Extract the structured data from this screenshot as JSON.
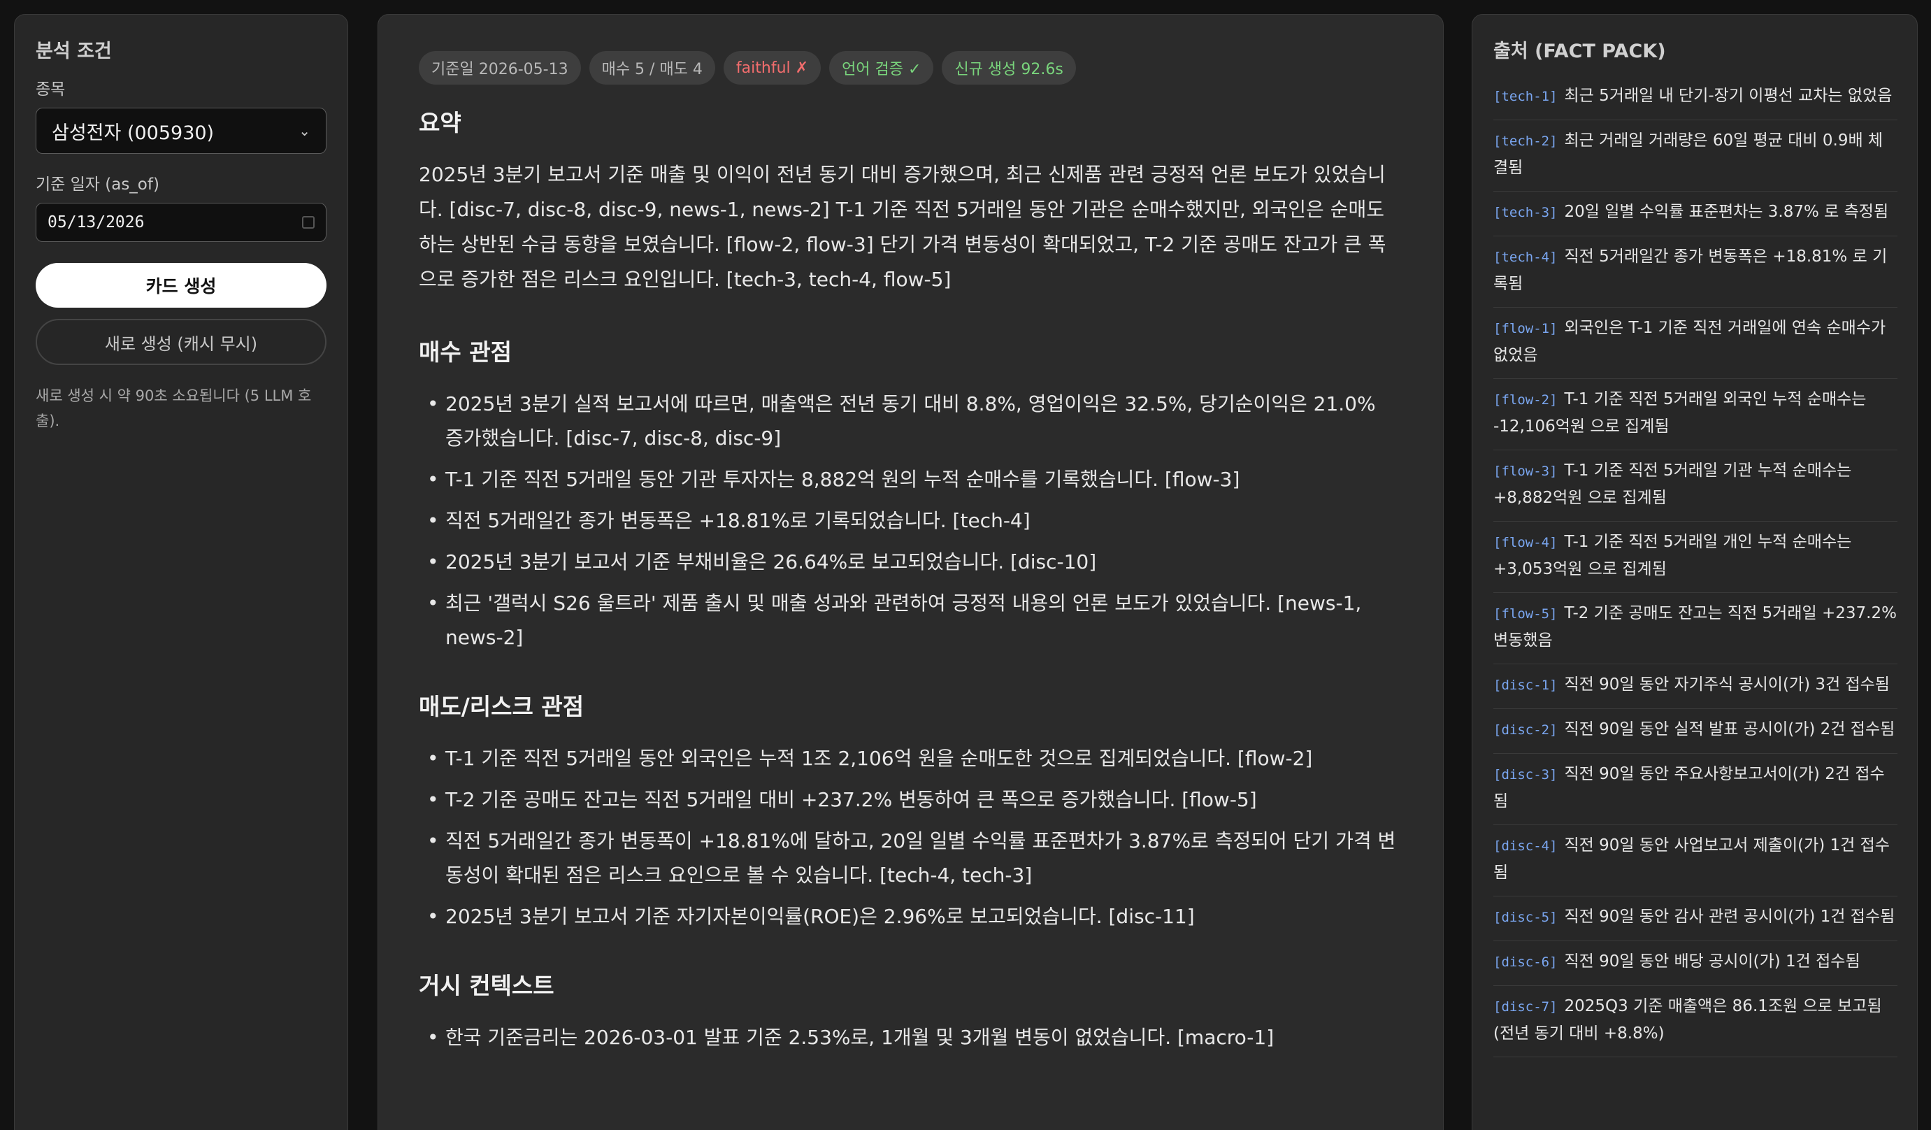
{
  "left_panel": {
    "title": "분석 조건",
    "ticker_label": "종목",
    "ticker_value": "삼성전자 (005930)",
    "date_label": "기준 일자 (as_of)",
    "date_value": "05/13/2026",
    "generate_button": "카드 생성",
    "regenerate_button": "새로 생성 (캐시 무시)",
    "hint": "새로 생성 시 약 90초 소요됩니다 (5 LLM 호출)."
  },
  "badges": [
    {
      "text": "기준일 2026-05-13"
    },
    {
      "text": "매수 5 / 매도 4"
    },
    {
      "text": "faithful ✗"
    },
    {
      "text": "언어 검증 ✓"
    },
    {
      "text": "신규 생성 92.6s"
    }
  ],
  "main": {
    "summary_title": "요약",
    "summary_text": "2025년 3분기 보고서 기준 매출 및 이익이 전년 동기 대비 증가했으며, 최근 신제품 관련 긍정적 언론 보도가 있었습니다. [disc-7, disc-8, disc-9, news-1, news-2] T-1 기준 직전 5거래일 동안 기관은 순매수했지만, 외국인은 순매도하는 상반된 수급 동향을 보였습니다. [flow-2, flow-3] 단기 가격 변동성이 확대되었고, T-2 기준 공매도 잔고가 큰 폭으로 증가한 점은 리스크 요인입니다. [tech-3, tech-4, flow-5]",
    "buy_title": "매수 관점",
    "buy_items": [
      "2025년 3분기 실적 보고서에 따르면, 매출액은 전년 동기 대비 8.8%, 영업이익은 32.5%, 당기순이익은 21.0% 증가했습니다. [disc-7, disc-8, disc-9]",
      "T-1 기준 직전 5거래일 동안 기관 투자자는 8,882억 원의 누적 순매수를 기록했습니다. [flow-3]",
      "직전 5거래일간 종가 변동폭은 +18.81%로 기록되었습니다. [tech-4]",
      "2025년 3분기 보고서 기준 부채비율은 26.64%로 보고되었습니다. [disc-10]",
      "최근 '갤럭시 S26 울트라' 제품 출시 및 매출 성과와 관련하여 긍정적 내용의 언론 보도가 있었습니다. [news-1, news-2]"
    ],
    "sell_title": "매도/리스크 관점",
    "sell_items": [
      "T-1 기준 직전 5거래일 동안 외국인은 누적 1조 2,106억 원을 순매도한 것으로 집계되었습니다. [flow-2]",
      "T-2 기준 공매도 잔고는 직전 5거래일 대비 +237.2% 변동하여 큰 폭으로 증가했습니다. [flow-5]",
      "직전 5거래일간 종가 변동폭이 +18.81%에 달하고, 20일 일별 수익률 표준편차가 3.87%로 측정되어 단기 가격 변동성이 확대된 점은 리스크 요인으로 볼 수 있습니다. [tech-4, tech-3]",
      "2025년 3분기 보고서 기준 자기자본이익률(ROE)은 2.96%로 보고되었습니다. [disc-11]"
    ],
    "macro_title": "거시 컨텍스트",
    "macro_items": [
      "한국 기준금리는 2026-03-01 발표 기준 2.53%로, 1개월 및 3개월 변동이 없었습니다. [macro-1]"
    ]
  },
  "facts": {
    "title": "출처 (FACT PACK)",
    "items": [
      {
        "tag": "[tech-1]",
        "text": "최근 5거래일 내 단기-장기 이평선 교차는 없었음"
      },
      {
        "tag": "[tech-2]",
        "text": "최근 거래일 거래량은 60일 평균 대비 0.9배 체결됨"
      },
      {
        "tag": "[tech-3]",
        "text": "20일 일별 수익률 표준편차는 3.87% 로 측정됨"
      },
      {
        "tag": "[tech-4]",
        "text": "직전 5거래일간 종가 변동폭은 +18.81% 로 기록됨"
      },
      {
        "tag": "[flow-1]",
        "text": "외국인은 T-1 기준 직전 거래일에 연속 순매수가 없었음"
      },
      {
        "tag": "[flow-2]",
        "text": "T-1 기준 직전 5거래일 외국인 누적 순매수는 -12,106억원 으로 집계됨"
      },
      {
        "tag": "[flow-3]",
        "text": "T-1 기준 직전 5거래일 기관 누적 순매수는 +8,882억원 으로 집계됨"
      },
      {
        "tag": "[flow-4]",
        "text": "T-1 기준 직전 5거래일 개인 누적 순매수는 +3,053억원 으로 집계됨"
      },
      {
        "tag": "[flow-5]",
        "text": "T-2 기준 공매도 잔고는 직전 5거래일 +237.2% 변동했음"
      },
      {
        "tag": "[disc-1]",
        "text": "직전 90일 동안 자기주식 공시이(가) 3건 접수됨"
      },
      {
        "tag": "[disc-2]",
        "text": "직전 90일 동안 실적 발표 공시이(가) 2건 접수됨"
      },
      {
        "tag": "[disc-3]",
        "text": "직전 90일 동안 주요사항보고서이(가) 2건 접수됨"
      },
      {
        "tag": "[disc-4]",
        "text": "직전 90일 동안 사업보고서 제출이(가) 1건 접수됨"
      },
      {
        "tag": "[disc-5]",
        "text": "직전 90일 동안 감사 관련 공시이(가) 1건 접수됨"
      },
      {
        "tag": "[disc-6]",
        "text": "직전 90일 동안 배당 공시이(가) 1건 접수됨"
      },
      {
        "tag": "[disc-7]",
        "text": "2025Q3 기준 매출액은 86.1조원 으로 보고됨 (전년 동기 대비 +8.8%)"
      }
    ]
  }
}
